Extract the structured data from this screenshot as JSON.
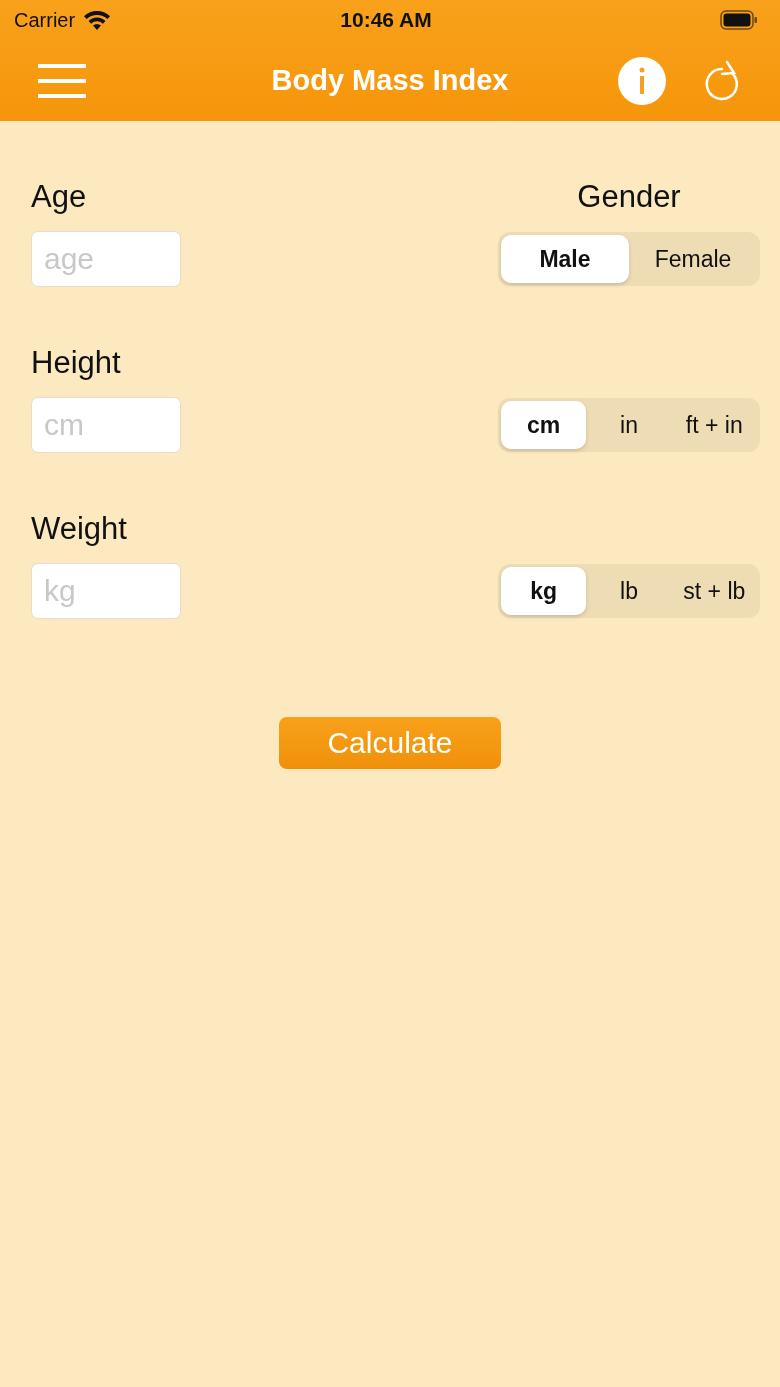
{
  "status_bar": {
    "carrier": "Carrier",
    "time": "10:46 AM"
  },
  "nav_bar": {
    "title": "Body Mass Index"
  },
  "fields": [
    {
      "label": "Age",
      "placeholder": "age",
      "segment_label": "Gender",
      "segments": [
        {
          "label": "Male",
          "selected": true
        },
        {
          "label": "Female",
          "selected": false
        }
      ]
    },
    {
      "label": "Height",
      "placeholder": "cm",
      "segments": [
        {
          "label": "cm",
          "selected": true
        },
        {
          "label": "in",
          "selected": false
        },
        {
          "label": "ft + in",
          "selected": false
        }
      ]
    },
    {
      "label": "Weight",
      "placeholder": "kg",
      "segments": [
        {
          "label": "kg",
          "selected": true
        },
        {
          "label": "lb",
          "selected": false
        },
        {
          "label": "st + lb",
          "selected": false
        }
      ]
    }
  ],
  "calculate_button": "Calculate"
}
